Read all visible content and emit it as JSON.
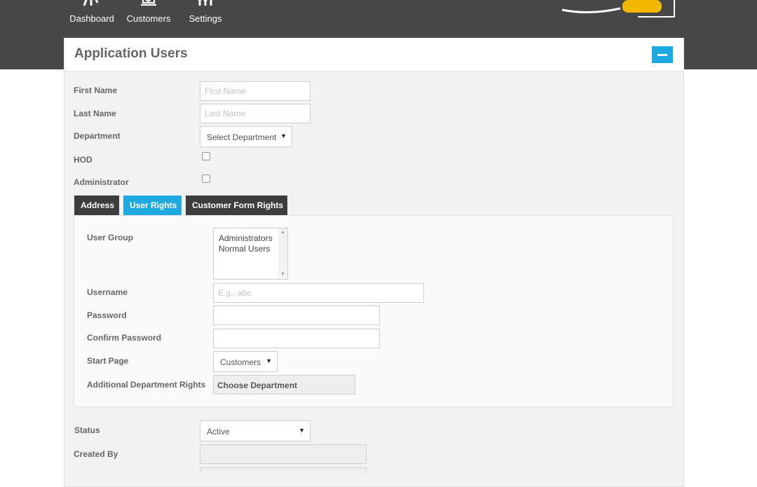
{
  "nav": {
    "items": [
      {
        "label": "Dashboard",
        "icon": "dashboard-icon"
      },
      {
        "label": "Customers",
        "icon": "customers-icon"
      },
      {
        "label": "Settings",
        "icon": "settings-icon"
      }
    ],
    "logo_icon": "company-logo"
  },
  "panel": {
    "title": "Application Users",
    "collapse_icon": "minus-icon",
    "accent_color": "#1ea9e1"
  },
  "form": {
    "first_name": {
      "label": "First Name",
      "placeholder": "First Name",
      "value": ""
    },
    "last_name": {
      "label": "Last Name",
      "placeholder": "Last Name",
      "value": ""
    },
    "department": {
      "label": "Department",
      "selected": "Select Department"
    },
    "hod": {
      "label": "HOD",
      "checked": false
    },
    "administrator": {
      "label": "Administrator",
      "checked": false
    }
  },
  "tabs": [
    {
      "label": "Address",
      "active": false
    },
    {
      "label": "User Rights",
      "active": true
    },
    {
      "label": "Customer Form Rights",
      "active": false
    }
  ],
  "rights": {
    "user_group": {
      "label": "User Group",
      "options": [
        "Administrators",
        "Normal Users"
      ]
    },
    "username": {
      "label": "Username",
      "placeholder": "E.g., abc",
      "value": ""
    },
    "password": {
      "label": "Password",
      "value": ""
    },
    "confirm_password": {
      "label": "Confirm Password",
      "value": ""
    },
    "start_page": {
      "label": "Start Page",
      "selected": "Customers"
    },
    "additional_rights": {
      "label": "Additional Department Rights",
      "button": "Choose Department"
    }
  },
  "status": {
    "label": "Status",
    "selected": "Active"
  },
  "created_by": {
    "label": "Created By",
    "value": ""
  }
}
